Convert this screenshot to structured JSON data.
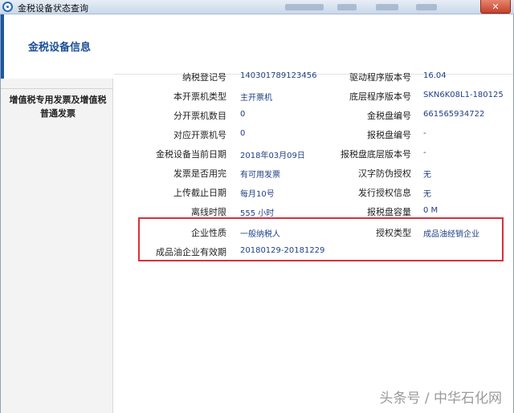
{
  "window": {
    "title": "金税设备状态查询",
    "close_glyph": "✕"
  },
  "sidebar": {
    "items": [
      {
        "label": "金税设备信息"
      },
      {
        "label": "增值税专用发票及增值税普通发票"
      }
    ]
  },
  "fields_left": [
    {
      "label": "纳税登记号",
      "value": "140301789123456"
    },
    {
      "label": "本开票机类型",
      "value": "主开票机"
    },
    {
      "label": "分开票机数目",
      "value": "0"
    },
    {
      "label": "对应开票机号",
      "value": "0"
    },
    {
      "label": "金税设备当前日期",
      "value": "2018年03月09日"
    },
    {
      "label": "发票是否用完",
      "value": "有可用发票"
    },
    {
      "label": "上传截止日期",
      "value": "每月10号"
    },
    {
      "label": "离线时限",
      "value": "555 小时"
    }
  ],
  "fields_right": [
    {
      "label": "驱动程序版本号",
      "value": "16.04"
    },
    {
      "label": "底层程序版本号",
      "value": "SKN6K08L1-180125"
    },
    {
      "label": "金税盘编号",
      "value": "661565934722"
    },
    {
      "label": "报税盘编号",
      "value": "-"
    },
    {
      "label": "报税盘底层版本号",
      "value": "-"
    },
    {
      "label": "汉字防伪授权",
      "value": "无"
    },
    {
      "label": "发行授权信息",
      "value": "无"
    },
    {
      "label": "报税盘容量",
      "value": "0 M"
    }
  ],
  "highlighted": {
    "enterprise_nature": {
      "label": "企业性质",
      "value": "一般纳税人"
    },
    "auth_type": {
      "label": "授权类型",
      "value": "成品油经销企业"
    },
    "validity": {
      "label": "成品油企业有效期",
      "value": "20180129-20181229"
    }
  },
  "watermark": "头条号 / 中华石化网",
  "colors": {
    "accent": "#1c57a0",
    "value_text": "#1f3f85",
    "highlight_border": "#d9303a"
  }
}
